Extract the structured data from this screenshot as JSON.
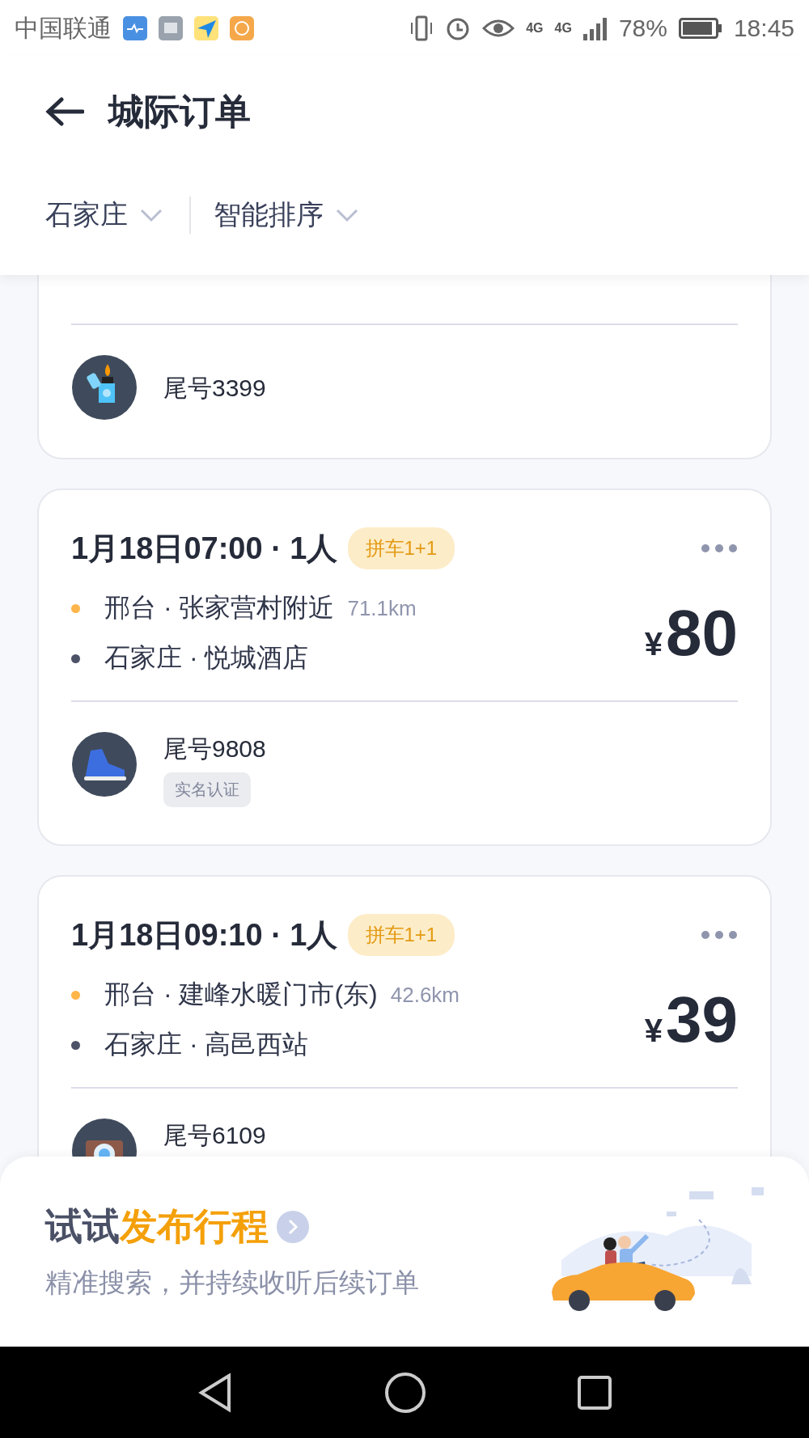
{
  "status_bar": {
    "carrier": "中国联通",
    "network_labels": [
      "4G",
      "4G"
    ],
    "battery": "78%",
    "time": "18:45"
  },
  "header": {
    "title": "城际订单",
    "filters": [
      {
        "label": "石家庄"
      },
      {
        "label": "智能排序"
      }
    ]
  },
  "orders": [
    {
      "kind": "partial",
      "tail": "尾号3399"
    },
    {
      "kind": "full",
      "datetime": "1月18日07:00 · 1人",
      "tag": "拼车1+1",
      "from": {
        "text": "邢台 · 张家营村附近",
        "distance": "71.1km"
      },
      "to": "石家庄 · 悦城酒店",
      "currency": "¥",
      "price": "80",
      "tail": "尾号9808",
      "badge": "实名认证"
    },
    {
      "kind": "full",
      "datetime": "1月18日09:10 · 1人",
      "tag": "拼车1+1",
      "from": {
        "text": "邢台 · 建峰水暖门市(东)",
        "distance": "42.6km"
      },
      "to": "石家庄 · 高邑西站",
      "currency": "¥",
      "price": "39",
      "tail": "尾号6109"
    }
  ],
  "banner": {
    "title_lead": "试试",
    "title_highlight": "发布行程",
    "subtitle": "精准搜索，并持续收听后续订单"
  }
}
